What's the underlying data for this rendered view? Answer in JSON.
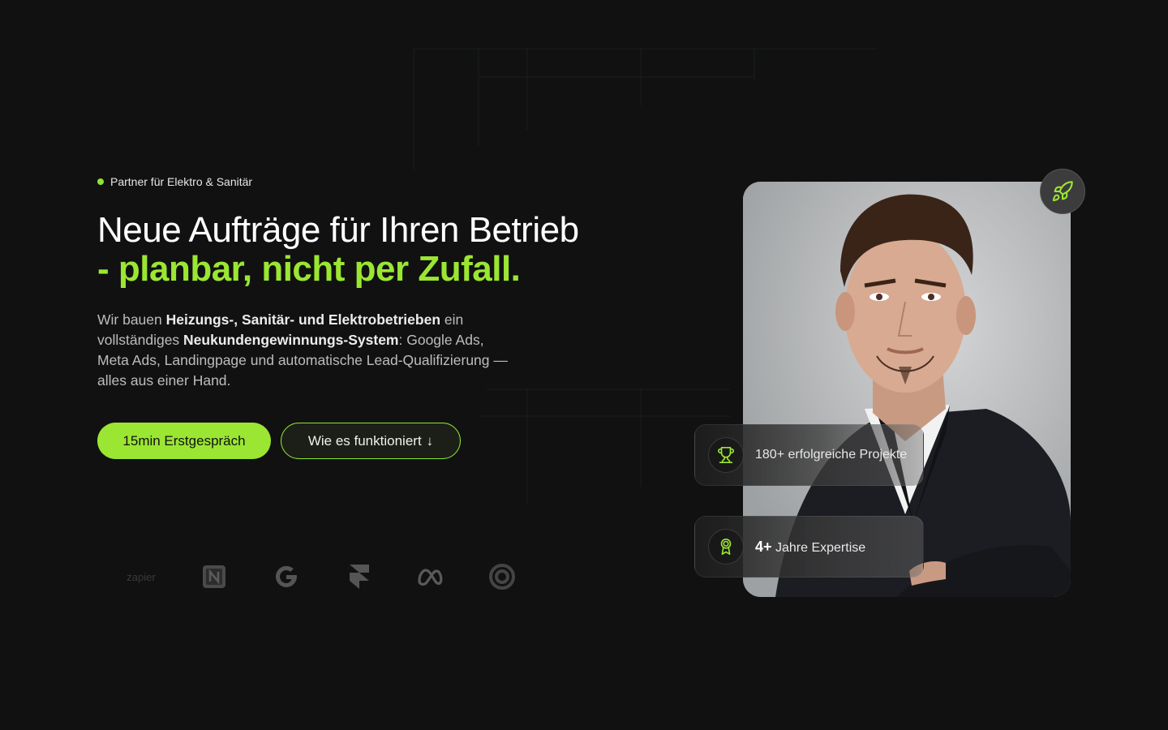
{
  "hero": {
    "eyebrow": "Partner für Elektro & Sanitär",
    "headline_line1": "Neue Aufträge für Ihren Betrieb",
    "headline_line2": "- planbar, nicht per Zufall.",
    "lead": {
      "t1": "Wir bauen ",
      "b1": "Heizungs-, Sanitär- und Elektrobetrieben",
      "t2": " ein vollständiges ",
      "b2": "Neukundengewinnungs-System",
      "t3": ": Google Ads, Meta Ads, Landingpage und automatische Lead-Qualifizierung — alles aus einer Hand."
    },
    "cta_primary": "15min Erstgespräch",
    "cta_secondary": "Wie es funktioniert",
    "cta_secondary_arrow": "↓"
  },
  "logos": {
    "zapier": "zapier",
    "icons": [
      "notion-icon",
      "google-icon",
      "framer-icon",
      "meta-icon",
      "cloud-icon"
    ]
  },
  "stats": [
    {
      "value": "180+",
      "label": "erfolgreiche Projekte",
      "icon": "trophy-icon"
    },
    {
      "value": "4+",
      "label": "Jahre Expertise",
      "icon": "award-icon"
    }
  ],
  "colors": {
    "background": "#111111",
    "accent": "#9be632"
  }
}
